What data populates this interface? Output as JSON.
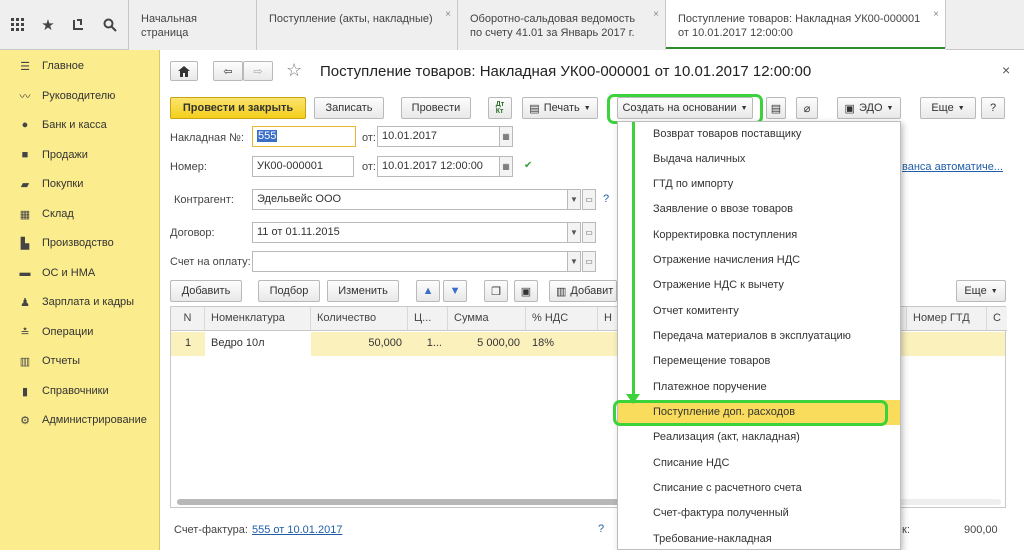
{
  "topbar": {
    "tabs": [
      {
        "label": "Начальная страница"
      },
      {
        "label": "Поступление (акты, накладные)"
      },
      {
        "label": "Оборотно-сальдовая ведомость по счету 41.01 за Январь 2017 г."
      },
      {
        "label": "Поступление товаров: Накладная УК00-000001 от 10.01.2017 12:00:00"
      }
    ],
    "close_glyph": "×"
  },
  "sidebar": {
    "items": [
      {
        "label": "Главное",
        "icon": "menu-icon"
      },
      {
        "label": "Руководителю",
        "icon": "chart-icon"
      },
      {
        "label": "Банк и касса",
        "icon": "coin-icon"
      },
      {
        "label": "Продажи",
        "icon": "bag-icon"
      },
      {
        "label": "Покупки",
        "icon": "cart-icon"
      },
      {
        "label": "Склад",
        "icon": "warehouse-icon"
      },
      {
        "label": "Производство",
        "icon": "factory-icon"
      },
      {
        "label": "ОС и НМА",
        "icon": "truck-icon"
      },
      {
        "label": "Зарплата и кадры",
        "icon": "person-icon"
      },
      {
        "label": "Операции",
        "icon": "operations-icon"
      },
      {
        "label": "Отчеты",
        "icon": "reports-icon"
      },
      {
        "label": "Справочники",
        "icon": "book-icon"
      },
      {
        "label": "Администрирование",
        "icon": "gear-icon"
      }
    ]
  },
  "document": {
    "title": "Поступление товаров: Накладная УК00-000001 от 10.01.2017 12:00:00",
    "close_glyph": "×"
  },
  "toolbar": {
    "post_close": "Провести и закрыть",
    "save": "Записать",
    "post": "Провести",
    "print": "Печать",
    "create_based": "Создать на основании",
    "edo": "ЭДО",
    "more": "Еще",
    "help": "?"
  },
  "form": {
    "invoice_label": "Накладная №:",
    "invoice_value": "555",
    "from_label": "от:",
    "invoice_date": "10.01.2017",
    "number_label": "Номер:",
    "number_value": "УК00-000001",
    "number_date": "10.01.2017 12:00:00",
    "counterparty_label": "Контрагент:",
    "counterparty_value": "Эдельвейс ООО",
    "contract_label": "Договор:",
    "contract_value": "11 от 01.11.2015",
    "payment_label": "Счет на оплату:",
    "payment_value": "",
    "advance_link": "ванса автоматиче..."
  },
  "table_toolbar": {
    "add": "Добавить",
    "pick": "Подбор",
    "change": "Изменить",
    "add2": "Добавит",
    "more": "Еще"
  },
  "table": {
    "headers": [
      "N",
      "Номенклатура",
      "Количество",
      "Ц...",
      "Сумма",
      "% НДС",
      "Н",
      "Номер ГТД",
      "С"
    ],
    "rows": [
      {
        "n": "1",
        "name": "Ведро 10л",
        "qty": "50,000",
        "price": "1...",
        "sum": "5 000,00",
        "vat": "18%"
      }
    ]
  },
  "footer": {
    "invoice_label": "Счет-фактура:",
    "invoice_link": "555 от 10.01.2017",
    "help": "?",
    "total_label": "к:",
    "total_value": "900,00"
  },
  "menu": {
    "items": [
      "Возврат товаров поставщику",
      "Выдача наличных",
      "ГТД по импорту",
      "Заявление о ввозе товаров",
      "Корректировка поступления",
      "Отражение начисления НДС",
      "Отражение НДС к вычету",
      "Отчет комитенту",
      "Передача материалов в эксплуатацию",
      "Перемещение товаров",
      "Платежное поручение",
      "Поступление доп. расходов",
      "Реализация (акт, накладная)",
      "Списание НДС",
      "Списание с расчетного счета",
      "Счет-фактура полученный",
      "Требование-накладная"
    ],
    "selected_index": 11
  },
  "colors": {
    "accent_green": "#3bd23b",
    "sidebar_bg": "#fbec8d",
    "primary_button": "#f4cf1c",
    "selected_row": "#fbf1bd",
    "link": "#1f5fa8"
  }
}
